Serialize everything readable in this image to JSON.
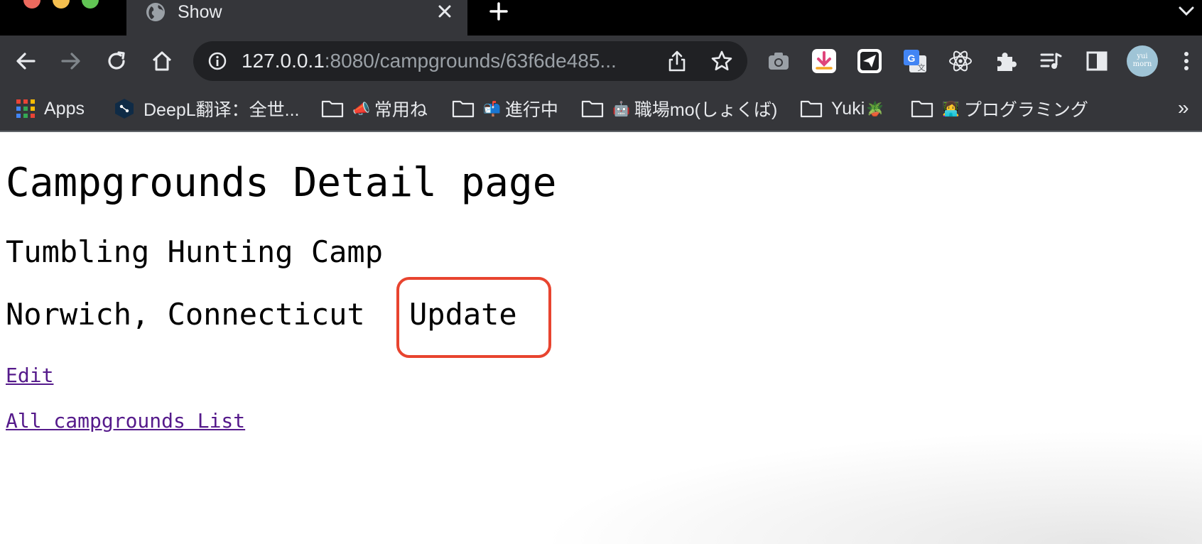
{
  "tab": {
    "title": "Show"
  },
  "address_bar": {
    "url_host": "127.0.0.1",
    "url_rest": ":8080/campgrounds/63f6de485..."
  },
  "extensions": [
    {
      "name": "camera-extension-icon",
      "color": "#9aa0a6"
    },
    {
      "name": "download-extension-icon",
      "color": "#ffffff"
    },
    {
      "name": "send-extension-icon",
      "color": "#ffffff"
    },
    {
      "name": "google-translate-icon",
      "color": "#4285f4"
    },
    {
      "name": "react-devtools-icon",
      "color": "#e8eaed"
    },
    {
      "name": "puzzle-extensions-icon",
      "color": "#e8eaed"
    },
    {
      "name": "media-queue-icon",
      "color": "#e8eaed"
    },
    {
      "name": "side-panel-icon",
      "color": "#e8eaed"
    }
  ],
  "profile": {
    "avatar_text": "yui morn"
  },
  "bookmarks": {
    "apps": "Apps",
    "deepl": "DeepL翻译：全世...",
    "folder1": "常用ね",
    "folder2": "進行中",
    "folder3": "職場mo(しょくば)",
    "folder4": "Yuki",
    "folder5": "プログラミング",
    "more": "»"
  },
  "page": {
    "title": "Campgrounds Detail page",
    "camp_name": "Tumbling Hunting Camp",
    "location": "Norwich, Connecticut",
    "update_text": "Update",
    "edit_link": "Edit",
    "all_link": "All campgrounds List"
  },
  "colors": {
    "highlight_box": "#e8442f",
    "visited_link": "#551a8b"
  }
}
